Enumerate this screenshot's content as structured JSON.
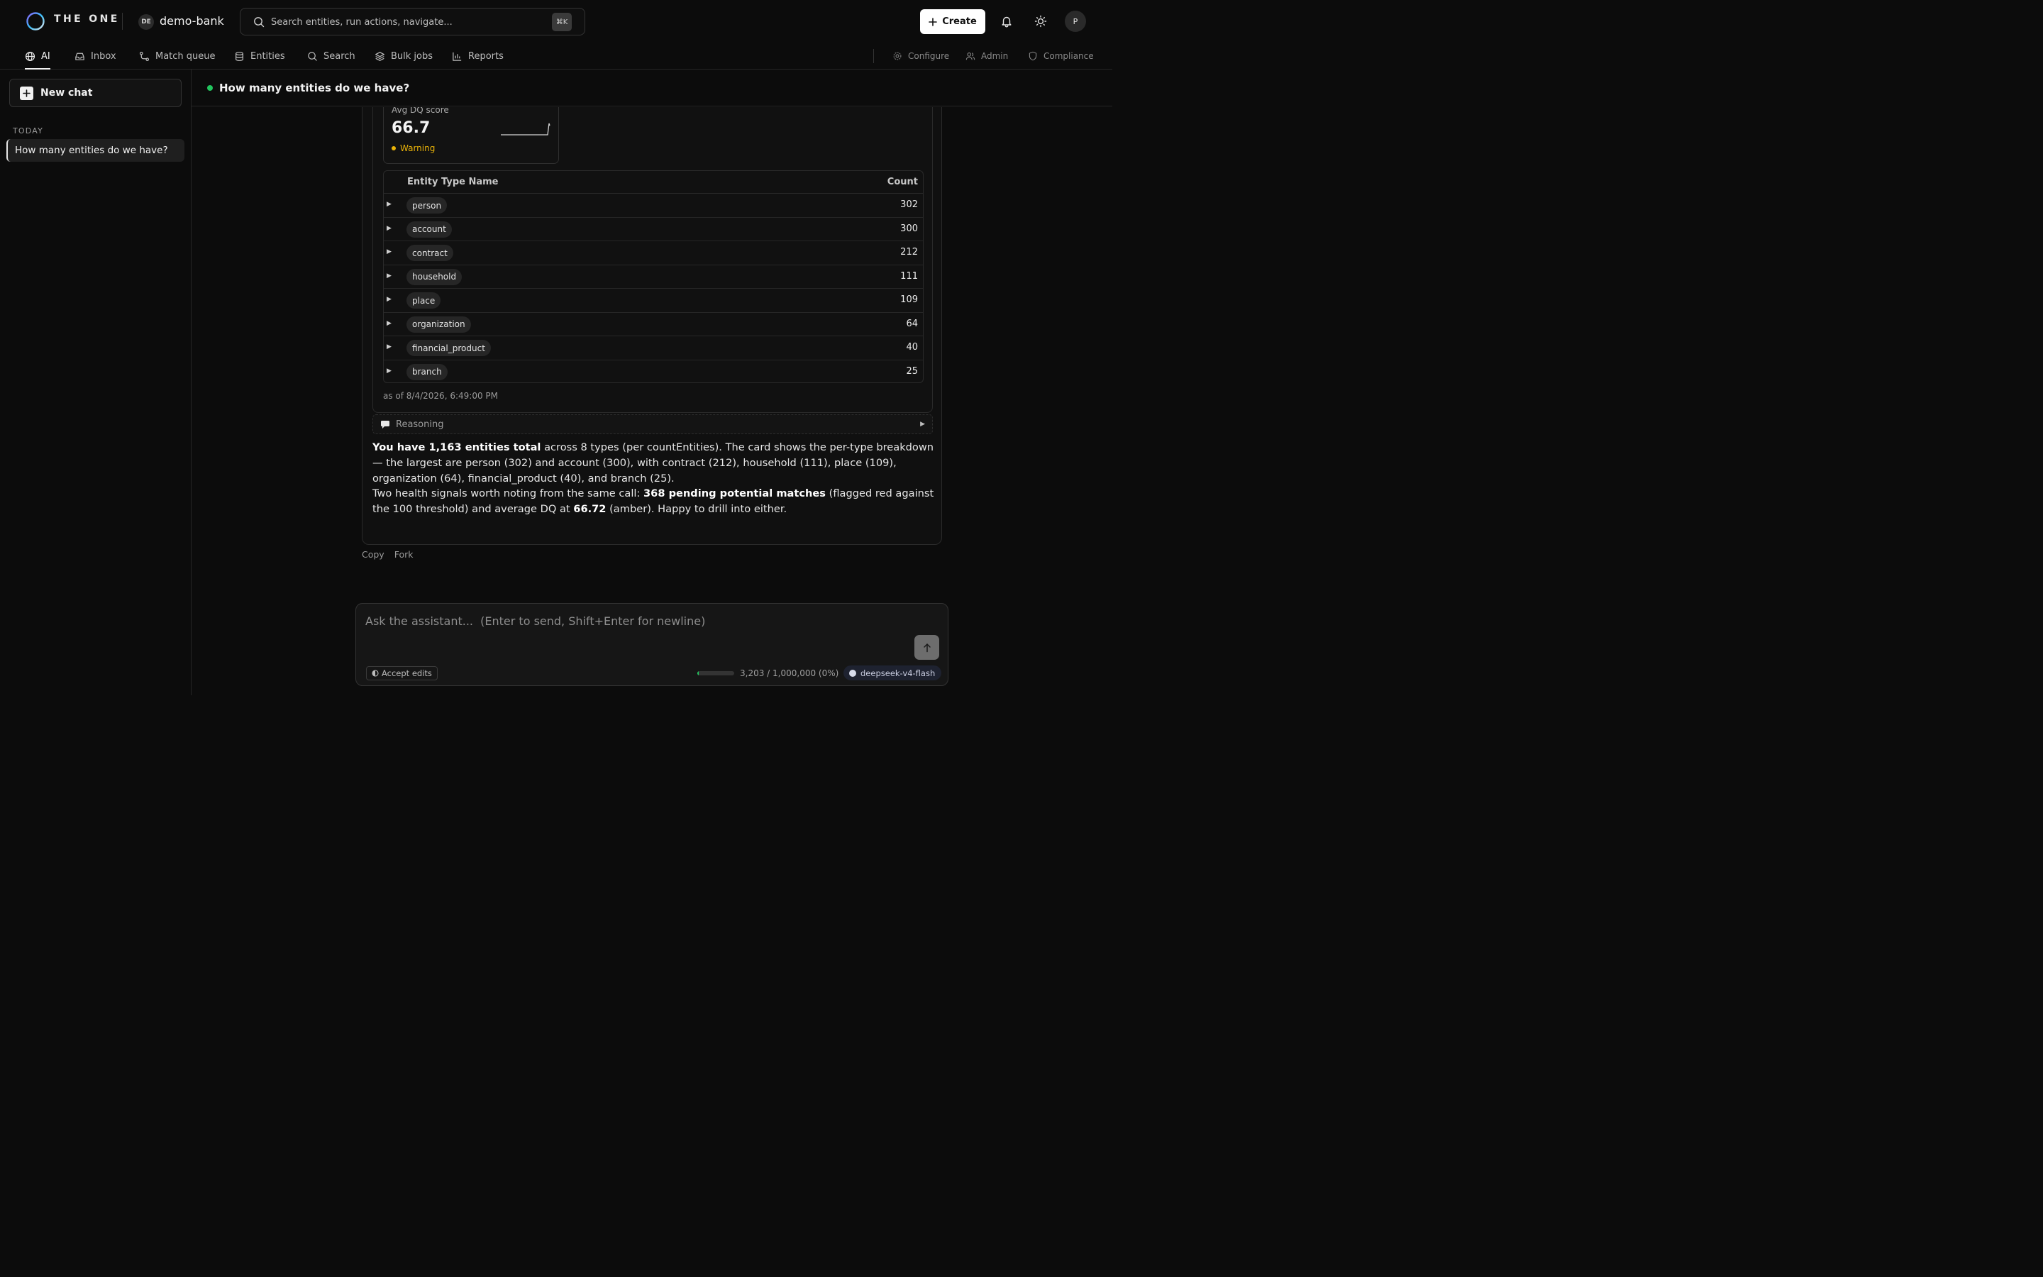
{
  "app": {
    "brand": "THE ONE",
    "workspace_initials": "DE",
    "workspace_name": "demo-bank",
    "search_placeholder": "Search entities, run actions, navigate...",
    "search_shortcut": "⌘K",
    "create_label": "Create",
    "user_initial": "P"
  },
  "nav": {
    "items": [
      {
        "label": "AI",
        "icon": "globe-icon",
        "active": true
      },
      {
        "label": "Inbox",
        "icon": "inbox-icon"
      },
      {
        "label": "Match queue",
        "icon": "route-icon"
      },
      {
        "label": "Entities",
        "icon": "database-icon"
      },
      {
        "label": "Search",
        "icon": "search-icon"
      },
      {
        "label": "Bulk jobs",
        "icon": "layers-icon"
      },
      {
        "label": "Reports",
        "icon": "bar-chart-icon"
      }
    ],
    "right_items": [
      {
        "label": "Configure",
        "icon": "gear-icon"
      },
      {
        "label": "Admin",
        "icon": "users-icon"
      },
      {
        "label": "Compliance",
        "icon": "shield-icon"
      }
    ]
  },
  "sidebar": {
    "new_chat_label": "New chat",
    "section_label": "TODAY",
    "chats": [
      {
        "title": "How many entities do we have?",
        "active": true
      }
    ]
  },
  "chat": {
    "title": "How many entities do we have?",
    "status_color": "#22c55e"
  },
  "card": {
    "dq_tile": {
      "label": "Avg DQ score",
      "value": "66.7",
      "status": "Warning",
      "status_color": "#eab308"
    },
    "table": {
      "headers": [
        "Entity Type Name",
        "Count"
      ],
      "rows": [
        {
          "type": "person",
          "count": "302"
        },
        {
          "type": "account",
          "count": "300"
        },
        {
          "type": "contract",
          "count": "212"
        },
        {
          "type": "household",
          "count": "111"
        },
        {
          "type": "place",
          "count": "109"
        },
        {
          "type": "organization",
          "count": "64"
        },
        {
          "type": "financial_product",
          "count": "40"
        },
        {
          "type": "branch",
          "count": "25"
        }
      ]
    },
    "as_of": "as of 8/4/2026, 6:49:00 PM"
  },
  "reasoning_label": "Reasoning",
  "answer": {
    "p1_bold": "You have 1,163 entities total",
    "p1_rest": " across 8 types (per countEntities). The card shows the per-type breakdown — the largest are person (302) and account (300), with contract (212), household (111), place (109), organization (64), financial_product (40), and branch (25).",
    "p2_a": "Two health signals worth noting from the same call: ",
    "p2_bold1": "368 pending potential matches",
    "p2_b": " (flagged red against the 100 threshold) and average DQ at ",
    "p2_bold2": "66.72",
    "p2_c": " (amber). Happy to drill into either."
  },
  "message_actions": {
    "copy": "Copy",
    "fork": "Fork"
  },
  "composer": {
    "placeholder": "Ask the assistant...  (Enter to send, Shift+Enter for newline)",
    "accept_edits": "Accept edits",
    "usage_text": "3,203 / 1,000,000 (0%)",
    "usage_fraction": 0.003203,
    "model": "deepseek-v4-flash"
  }
}
